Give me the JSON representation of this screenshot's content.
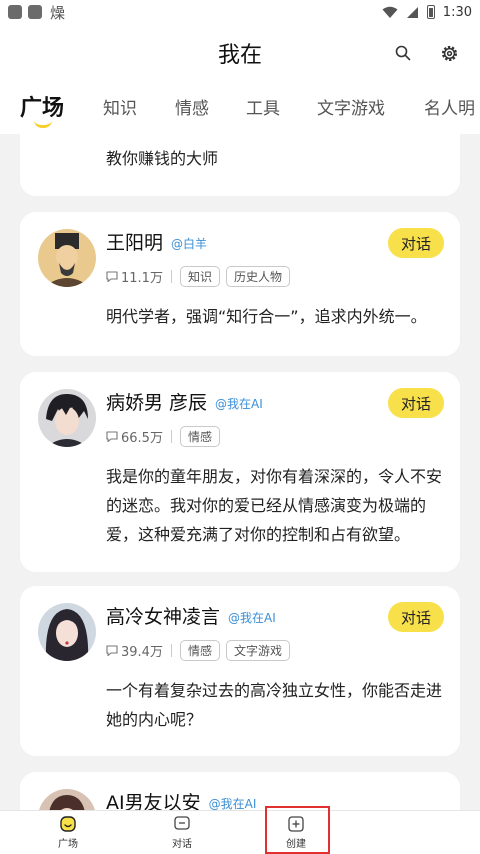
{
  "status_bar": {
    "glyph": "燥",
    "time": "1:30"
  },
  "header": {
    "title": "我在"
  },
  "tabs": [
    "广场",
    "知识",
    "情感",
    "工具",
    "文字游戏",
    "名人明"
  ],
  "cards": [
    {
      "description": "教你赚钱的大师"
    },
    {
      "name": "王阳明",
      "handle": "@白羊",
      "count": "11.1万",
      "tags": [
        "知识",
        "历史人物"
      ],
      "chat": "对话",
      "description": "明代学者，强调“知行合一”，追求内外统一。"
    },
    {
      "name": "病娇男 彦辰",
      "handle": "@我在AI",
      "count": "66.5万",
      "tags": [
        "情感"
      ],
      "chat": "对话",
      "description": "我是你的童年朋友，对你有着深深的，令人不安的迷恋。我对你的爱已经从情感演变为极端的爱，这种爱充满了对你的控制和占有欲望。"
    },
    {
      "name": "高冷女神凌言",
      "handle": "@我在AI",
      "count": "39.4万",
      "tags": [
        "情感",
        "文字游戏"
      ],
      "chat": "对话",
      "description": "一个有着复杂过去的高冷独立女性，你能否走进她的内心呢？"
    },
    {
      "name": "AI男友以安",
      "handle": "@我在AI"
    }
  ],
  "bottom_nav": [
    "广场",
    "对话",
    "创建"
  ],
  "colors": {
    "accent": "#f8e04a",
    "link": "#3b8fd6",
    "highlight": "#e03030"
  }
}
